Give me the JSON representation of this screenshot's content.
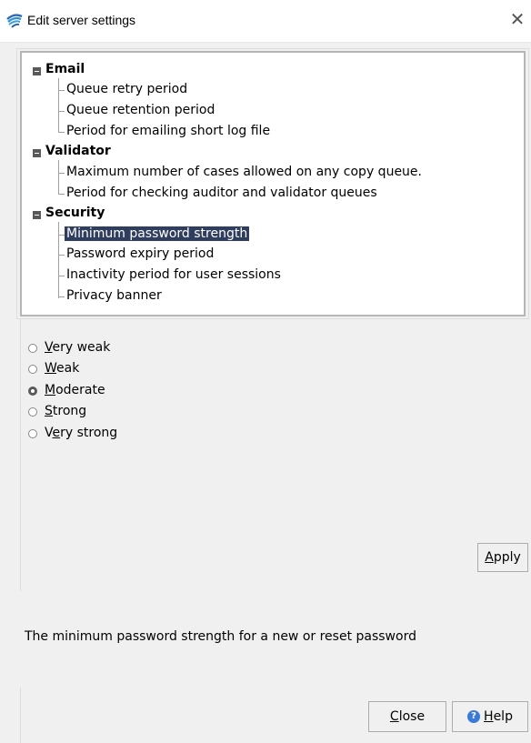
{
  "window": {
    "title": "Edit server settings",
    "close_glyph": "✕"
  },
  "tree": {
    "groups": [
      {
        "label": "Email",
        "items": [
          "Queue retry period",
          "Queue retention period",
          "Period for emailing short log file"
        ]
      },
      {
        "label": "Validator",
        "items": [
          "Maximum number of cases allowed on any copy queue.",
          "Period for checking auditor and validator queues"
        ]
      },
      {
        "label": "Security",
        "items": [
          "Minimum password strength",
          "Password expiry period",
          "Inactivity period for user sessions",
          "Privacy banner"
        ]
      }
    ],
    "selected_item": "Minimum password strength"
  },
  "strength_options": {
    "options": [
      {
        "mnemonic": "V",
        "rest": "ery weak",
        "checked": false
      },
      {
        "mnemonic": "W",
        "rest": "eak",
        "checked": false
      },
      {
        "mnemonic": "M",
        "rest": "oderate",
        "checked": true
      },
      {
        "mnemonic": "S",
        "rest": "trong",
        "checked": false
      },
      {
        "pre": "V",
        "mnemonic": "e",
        "rest": "ry strong",
        "checked": false
      }
    ]
  },
  "buttons": {
    "apply": {
      "mnemonic": "A",
      "rest": "pply"
    },
    "close": {
      "mnemonic": "C",
      "rest": "lose"
    },
    "help": {
      "mnemonic": "H",
      "rest": "elp"
    }
  },
  "description": "The minimum password strength for a new or reset password"
}
